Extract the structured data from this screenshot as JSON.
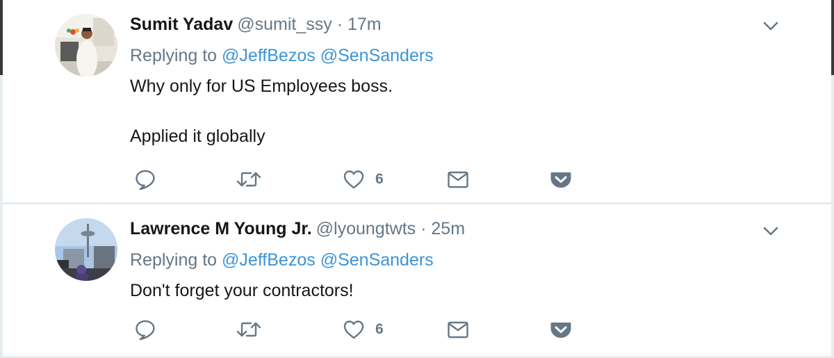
{
  "colors": {
    "name": "#14171a",
    "muted": "#657786",
    "link": "#3b94d9",
    "separator": "#e6ecf0",
    "icon": "#657786"
  },
  "icons": {
    "reply": "speech-bubble",
    "retweet": "retweet-arrows",
    "like": "heart-outline",
    "dm": "envelope",
    "pocket": "pocket-save",
    "more": "chevron-down"
  },
  "tweets": [
    {
      "name": "Sumit Yadav",
      "handle": "@sumit_ssy",
      "separator": "·",
      "time": "17m",
      "replying_label": "Replying to",
      "mentions": [
        "@JeffBezos",
        "@SenSanders"
      ],
      "paragraphs": [
        "Why only for US Employees boss.",
        "Applied it globally"
      ],
      "like_count": "6"
    },
    {
      "name": "Lawrence M Young Jr.",
      "handle": "@lyoungtwts",
      "separator": "·",
      "time": "25m",
      "replying_label": "Replying to",
      "mentions": [
        "@JeffBezos",
        "@SenSanders"
      ],
      "paragraphs": [
        "Don't forget your contractors!"
      ],
      "like_count": "6"
    }
  ]
}
